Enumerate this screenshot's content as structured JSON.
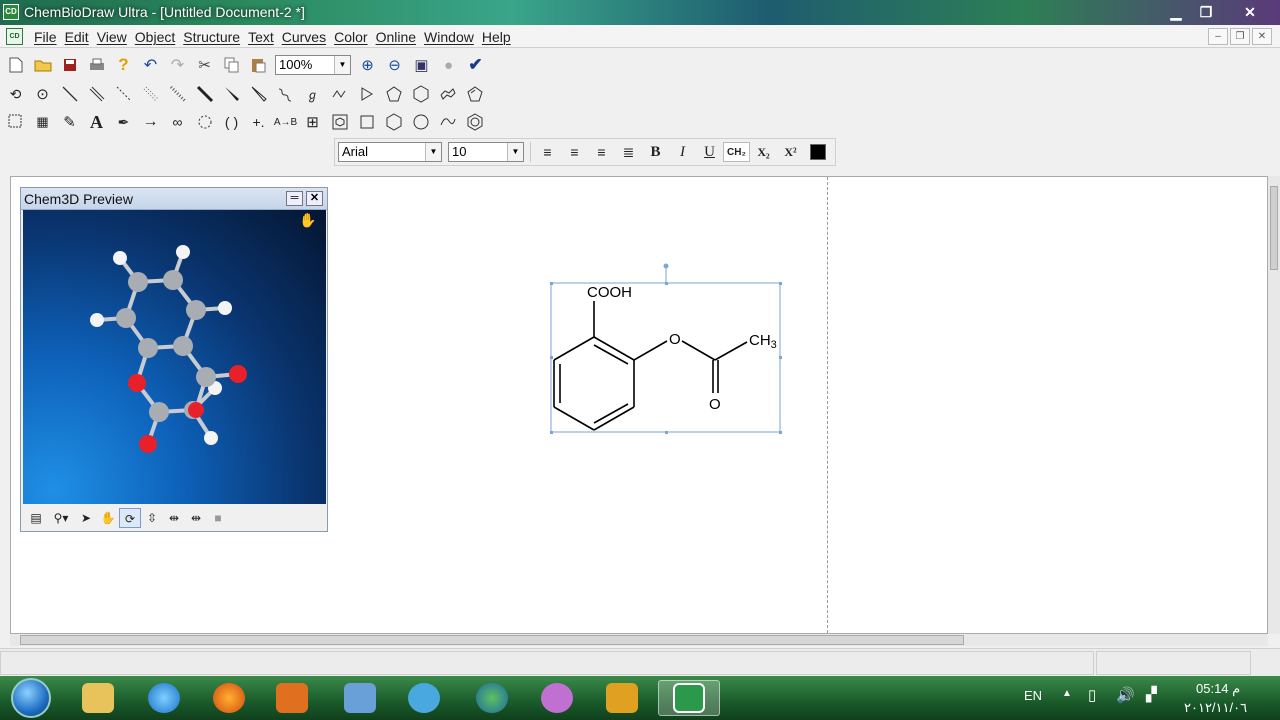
{
  "window": {
    "title": "ChemBioDraw Ultra - [Untitled Document-2 *]",
    "minimize_glyph": "▁",
    "maximize_glyph": "❐",
    "close_glyph": "✕"
  },
  "menu": {
    "items": [
      "File",
      "Edit",
      "View",
      "Object",
      "Structure",
      "Text",
      "Curves",
      "Color",
      "Online",
      "Window",
      "Help"
    ],
    "mdi_minimize": "–",
    "mdi_restore": "❐",
    "mdi_close": "✕"
  },
  "toolbar": {
    "zoom_value": "100%"
  },
  "format": {
    "font_value": "Arial",
    "size_value": "10",
    "bold": "B",
    "italic": "I",
    "underline": "U",
    "formula": "CH₂",
    "subscript": "X₂",
    "superscript": "X²"
  },
  "chem3d": {
    "title": "Chem3D Preview"
  },
  "structure": {
    "labels": {
      "cooh": "COOH",
      "ester_o": "O",
      "carbonyl_o": "O",
      "ch3": "CH",
      "ch3_sub": "3"
    }
  },
  "taskbar": {
    "language": "EN",
    "time": "05:14 م",
    "date": "٢٠١٢/١١/٠٦"
  }
}
